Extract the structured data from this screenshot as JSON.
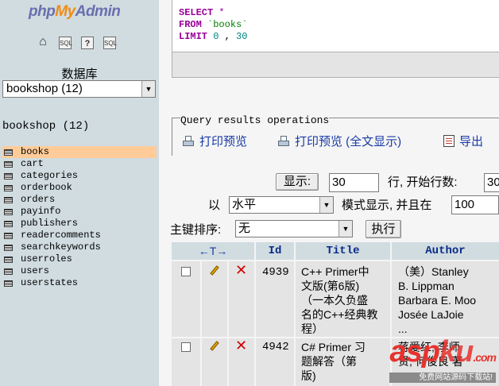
{
  "logo": {
    "text_php": "php",
    "text_my": "My",
    "text_admin": "Admin"
  },
  "left": {
    "icons": [
      "home-icon",
      "sql-query-icon",
      "help-icon",
      "sql-docs-icon"
    ],
    "icon_labels": {
      "sql": "SQL",
      "help": "?",
      "docs": "SQL"
    },
    "database_label": "数据库",
    "database_select": "bookshop (12)",
    "db_heading": "bookshop (12)",
    "tables": [
      {
        "name": "books",
        "active": true
      },
      {
        "name": "cart",
        "active": false
      },
      {
        "name": "categories",
        "active": false
      },
      {
        "name": "orderbook",
        "active": false
      },
      {
        "name": "orders",
        "active": false
      },
      {
        "name": "payinfo",
        "active": false
      },
      {
        "name": "publishers",
        "active": false
      },
      {
        "name": "readercomments",
        "active": false
      },
      {
        "name": "searchkeywords",
        "active": false
      },
      {
        "name": "userroles",
        "active": false
      },
      {
        "name": "users",
        "active": false
      },
      {
        "name": "userstates",
        "active": false
      }
    ]
  },
  "sql": {
    "line1_kw": "SELECT",
    "line1_rest": " *",
    "line2_kw": "FROM",
    "line2_str": " `books`",
    "line3_kw": "LIMIT",
    "line3_a": " 0",
    "line3_sep": " , ",
    "line3_b": "30"
  },
  "query_ops": {
    "title": "Query results operations",
    "print_view": "打印预览",
    "print_view_full": "打印预览 (全文显示)",
    "export": "导出"
  },
  "nav": {
    "show_button": "显示:",
    "rows_value": "30",
    "start_row_label": "行, 开始行数:",
    "start_row_value": "30",
    "in_label": "以",
    "mode_value": "水平",
    "mode_label": "模式显示, 并且在",
    "repeat_value": "100"
  },
  "sort": {
    "label": "主键排序:",
    "value": "无",
    "go_button": "执行"
  },
  "table": {
    "arrows": "←T→",
    "headers": [
      "Id",
      "Title",
      "Author"
    ],
    "rows": [
      {
        "id": "4939",
        "title": [
          "C++ Primer中",
          "文版(第6版)",
          "（一本久负盛",
          "名的C++经典教",
          "程）"
        ],
        "author": [
          "（美）Stanley",
          "B. Lippman",
          "Barbara E. Moo",
          "Josée LaJoie",
          "..."
        ]
      },
      {
        "id": "4942",
        "title": [
          "C# Primer 习",
          "题解答（第",
          "版)"
        ],
        "author": [
          "蒋爱红, 李师",
          "贤, 何俊良 著"
        ]
      }
    ]
  },
  "watermark": {
    "logo": "asp",
    "logo_suffix": "ku",
    "logo_tld": ".com",
    "sub": "免费网站源码下载站!"
  },
  "colors": {
    "left_bg": "#d0dce0",
    "active_row": "#ffcc99",
    "header_text": "#0a2a88",
    "keyword": "#990099",
    "string": "#008000",
    "number": "#008080",
    "link": "#1a3aa8"
  }
}
